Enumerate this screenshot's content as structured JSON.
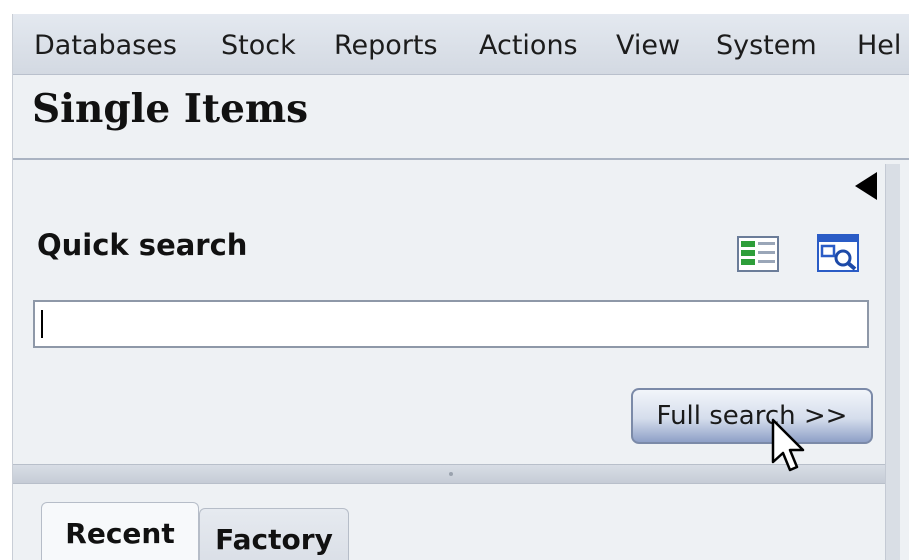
{
  "menubar": {
    "items": [
      {
        "label": "Databases"
      },
      {
        "label": "Stock"
      },
      {
        "label": "Reports"
      },
      {
        "label": "Actions"
      },
      {
        "label": "View"
      },
      {
        "label": "System"
      },
      {
        "label": "Hel"
      }
    ]
  },
  "page": {
    "title": "Single Items"
  },
  "quick_search": {
    "label": "Quick search",
    "input_value": "",
    "full_search_label": "Full search >>",
    "icons": [
      "list-view-icon",
      "search-document-icon"
    ]
  },
  "tabs": [
    {
      "label": "Recent",
      "active": true
    },
    {
      "label": "Factory",
      "active": false
    }
  ],
  "colors": {
    "background": "#eef1f4",
    "menubar": "#d3d9e2",
    "button_accent": "#8ea0c7",
    "icon_green": "#2e9e3a",
    "icon_blue": "#2a5cc6"
  }
}
